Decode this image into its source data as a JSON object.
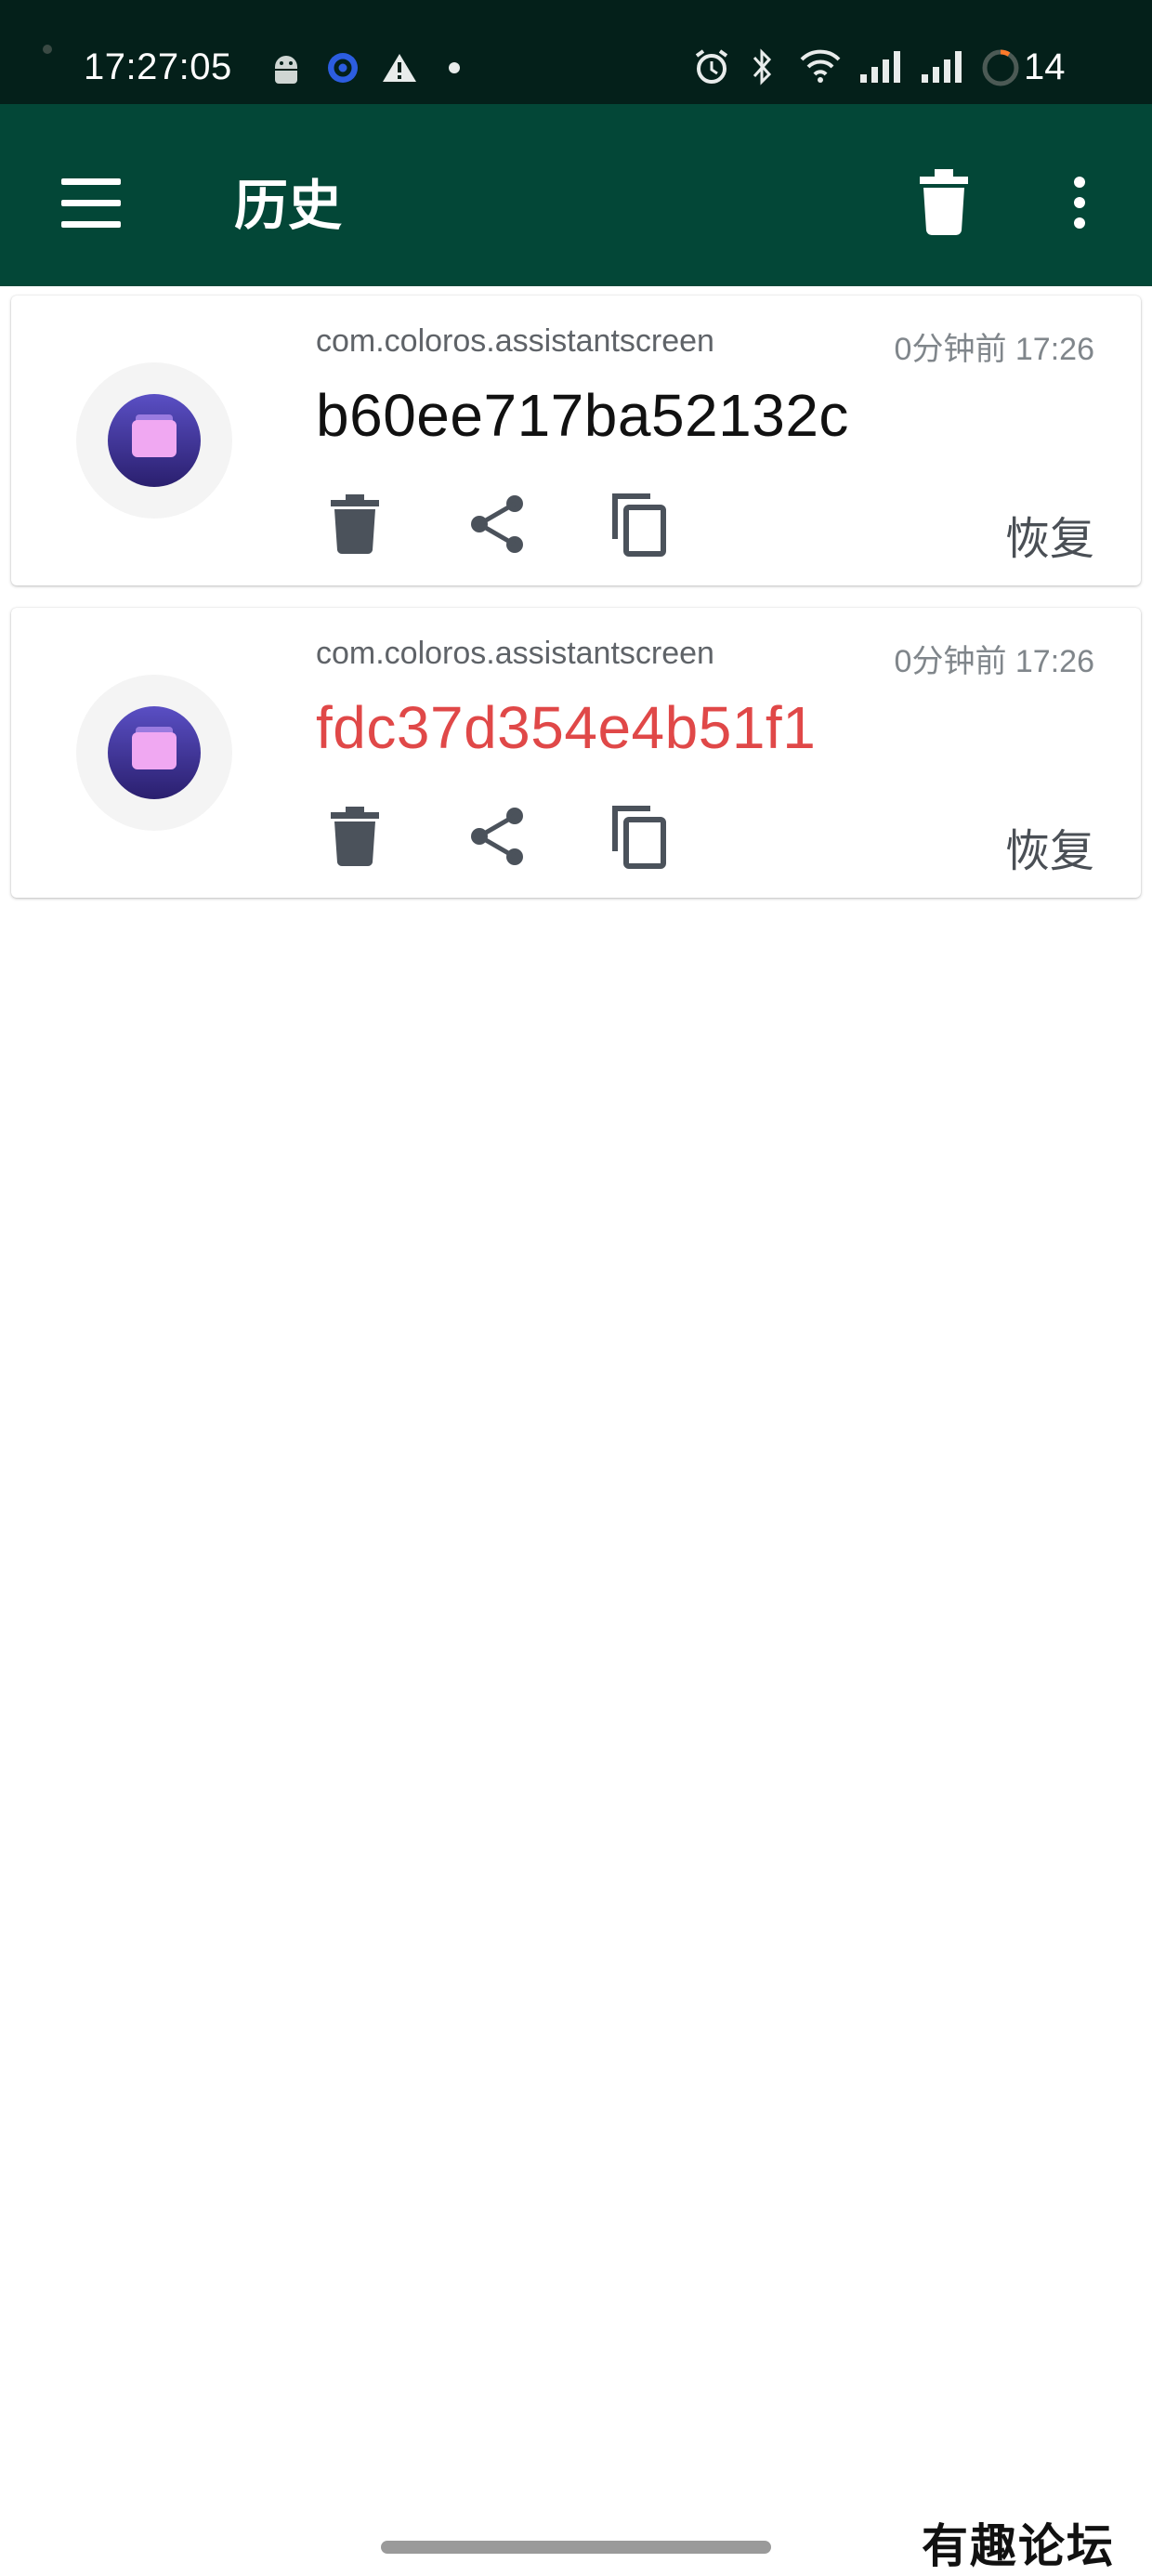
{
  "status_bar": {
    "time": "17:27:05",
    "battery": "14"
  },
  "app_bar": {
    "title": "历史"
  },
  "history": [
    {
      "package": "com.coloros.assistantscreen",
      "time_ago": "0分钟前 17:26",
      "code": "b60ee717ba52132c",
      "code_color": "#111111",
      "restore_label": "恢复"
    },
    {
      "package": "com.coloros.assistantscreen",
      "time_ago": "0分钟前 17:26",
      "code": "fdc37d354e4b51f1",
      "code_color": "#e04848",
      "restore_label": "恢复"
    }
  ],
  "watermark": "有趣论坛",
  "colors": {
    "status_bar_bg": "#04201a",
    "app_bar_bg": "#034737",
    "icon_gray": "#4b525b",
    "highlight_red": "#e04848"
  }
}
